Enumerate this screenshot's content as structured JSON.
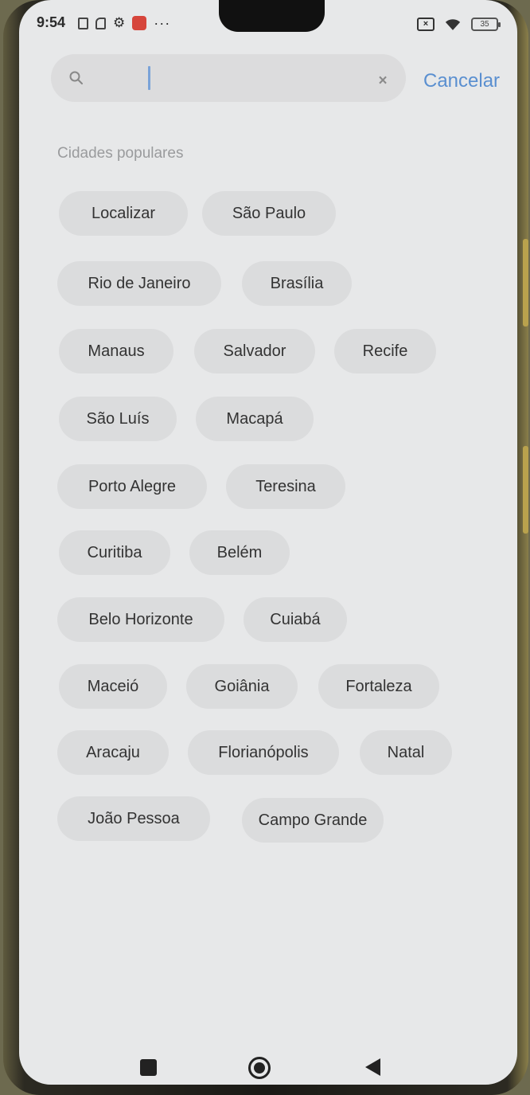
{
  "status_bar": {
    "time": "9:54",
    "battery": "35",
    "icons": [
      "screen-record-icon",
      "sim-icon",
      "gear-icon",
      "mail-icon",
      "more-dots-icon",
      "no-sim-icon",
      "wifi-icon",
      "battery-icon"
    ]
  },
  "search": {
    "value": "",
    "placeholder": "",
    "clear_label": "×",
    "cancel_label": "Cancelar"
  },
  "popular": {
    "title": "Cidades populares",
    "cities": [
      "Localizar",
      "São Paulo",
      "Rio de Janeiro",
      "Brasília",
      "Manaus",
      "Salvador",
      "Recife",
      "São Luís",
      "Macapá",
      "Porto Alegre",
      "Teresina",
      "Curitiba",
      "Belém",
      "Belo Horizonte",
      "Cuiabá",
      "Maceió",
      "Goiânia",
      "Fortaleza",
      "Aracaju",
      "Florianópolis",
      "Natal",
      "João Pessoa",
      "Campo Grande"
    ]
  },
  "navbar": {
    "buttons": [
      "recent-apps",
      "home",
      "back"
    ]
  }
}
